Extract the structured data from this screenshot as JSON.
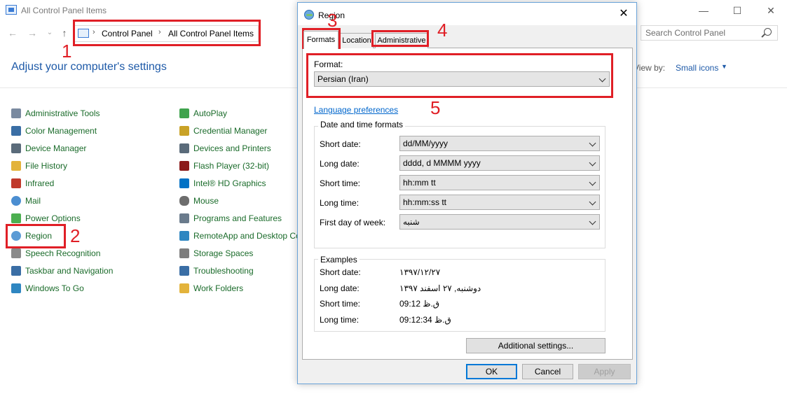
{
  "window": {
    "title": "All Control Panel Items",
    "minimize_glyph": "—",
    "maximize_glyph": "☐",
    "close_glyph": "✕"
  },
  "nav": {
    "back_glyph": "←",
    "forward_glyph": "→",
    "recent_glyph": "⌄",
    "up_glyph": "↑",
    "breadcrumb": [
      "Control Panel",
      "All Control Panel Items"
    ],
    "separator": "›"
  },
  "search": {
    "placeholder": "Search Control Panel"
  },
  "header": {
    "title": "Adjust your computer's settings",
    "view_by_label": "View by:",
    "view_by_value": "Small icons"
  },
  "items_col1": [
    {
      "label": "Administrative Tools",
      "icon": "admin-tools-icon",
      "color": "#7a8aa0"
    },
    {
      "label": "Color Management",
      "icon": "color-management-icon",
      "color": "#3a6ea5"
    },
    {
      "label": "Device Manager",
      "icon": "device-manager-icon",
      "color": "#5a6b7a"
    },
    {
      "label": "File History",
      "icon": "file-history-icon",
      "color": "#e3b33b"
    },
    {
      "label": "Infrared",
      "icon": "infrared-icon",
      "color": "#c0392b"
    },
    {
      "label": "Mail",
      "icon": "mail-icon",
      "color": "#4b8ed1"
    },
    {
      "label": "Power Options",
      "icon": "power-options-icon",
      "color": "#4caf50"
    },
    {
      "label": "Region",
      "icon": "region-icon",
      "color": "#5b9bd5"
    },
    {
      "label": "Speech Recognition",
      "icon": "speech-recognition-icon",
      "color": "#8a8a8a"
    },
    {
      "label": "Taskbar and Navigation",
      "icon": "taskbar-icon",
      "color": "#3a6ea5"
    },
    {
      "label": "Windows To Go",
      "icon": "windows-to-go-icon",
      "color": "#2e86c1"
    }
  ],
  "items_col2": [
    {
      "label": "AutoPlay",
      "icon": "autoplay-icon",
      "color": "#3fa34d"
    },
    {
      "label": "Credential Manager",
      "icon": "credential-manager-icon",
      "color": "#c9a227"
    },
    {
      "label": "Devices and Printers",
      "icon": "devices-printers-icon",
      "color": "#5a6b7a"
    },
    {
      "label": "Flash Player (32-bit)",
      "icon": "flash-player-icon",
      "color": "#8b1a1a"
    },
    {
      "label": "Intel® HD Graphics",
      "icon": "intel-graphics-icon",
      "color": "#0071c5"
    },
    {
      "label": "Mouse",
      "icon": "mouse-icon",
      "color": "#6d6d6d"
    },
    {
      "label": "Programs and Features",
      "icon": "programs-features-icon",
      "color": "#6a7b8c"
    },
    {
      "label": "RemoteApp and Desktop Co",
      "icon": "remoteapp-icon",
      "color": "#2e86c1"
    },
    {
      "label": "Storage Spaces",
      "icon": "storage-spaces-icon",
      "color": "#7d7d7d"
    },
    {
      "label": "Troubleshooting",
      "icon": "troubleshooting-icon",
      "color": "#3a6ea5"
    },
    {
      "label": "Work Folders",
      "icon": "work-folders-icon",
      "color": "#e3b33b"
    }
  ],
  "dialog": {
    "title": "Region",
    "close_glyph": "✕",
    "tabs": [
      "Formats",
      "Location",
      "Administrative"
    ],
    "format_label": "Format:",
    "format_value": "Persian (Iran)",
    "language_link": "Language preferences",
    "datetime_group": "Date and time formats",
    "rows": [
      {
        "label": "Short date:",
        "value": "dd/MM/yyyy"
      },
      {
        "label": "Long date:",
        "value": "dddd, d MMMM yyyy"
      },
      {
        "label": "Short time:",
        "value": "hh:mm tt"
      },
      {
        "label": "Long time:",
        "value": "hh:mm:ss tt"
      },
      {
        "label": "First day of week:",
        "value": "شنبه"
      }
    ],
    "examples_group": "Examples",
    "examples": [
      {
        "label": "Short date:",
        "value": "۱۳۹۷/۱۲/۲۷"
      },
      {
        "label": "Long date:",
        "value": "دوشنبه, ۲۷ اسفند ۱۳۹۷"
      },
      {
        "label": "Short time:",
        "value": "09:12 ق.ظ"
      },
      {
        "label": "Long time:",
        "value": "09:12:34 ق.ظ"
      }
    ],
    "additional_button": "Additional settings...",
    "ok_button": "OK",
    "cancel_button": "Cancel",
    "apply_button": "Apply"
  },
  "annotations": [
    "1",
    "2",
    "3",
    "4",
    "5"
  ],
  "colors": {
    "annotation_red": "#e01f26",
    "link_blue": "#1e5aa8",
    "item_green": "#1a6b2a"
  }
}
